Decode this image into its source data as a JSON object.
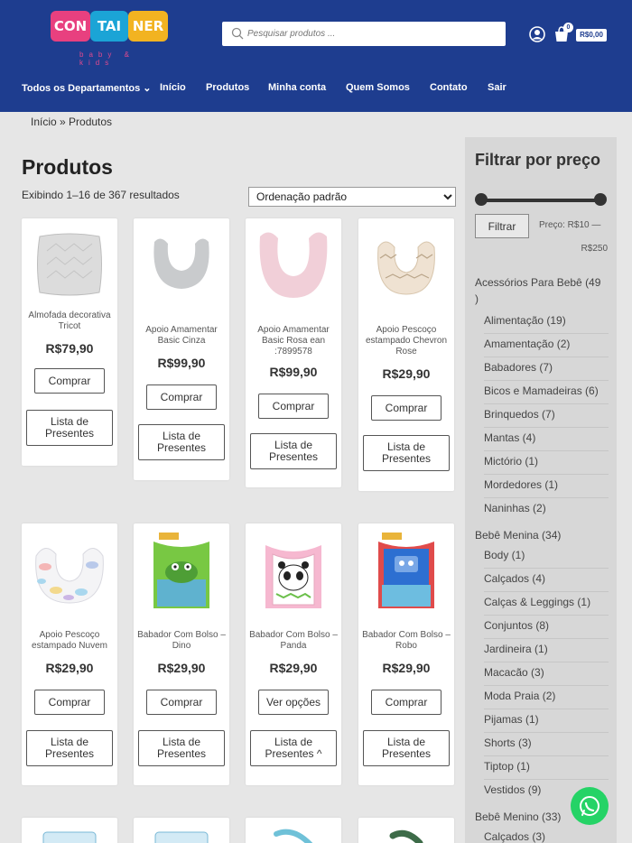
{
  "header": {
    "logo": {
      "blocks": [
        "CON",
        "TAI",
        "NER"
      ],
      "tagline": "baby & kids"
    },
    "search": {
      "placeholder": "Pesquisar produtos ..."
    },
    "cart": {
      "count": "0",
      "total": "R$0,00"
    }
  },
  "nav": {
    "items": [
      "Todos os Departamentos",
      "Início",
      "Produtos",
      "Minha conta",
      "Quem Somos",
      "Contato",
      "Sair"
    ]
  },
  "breadcrumb": "Início » Produtos",
  "main": {
    "title": "Produtos",
    "result_count": "Exibindo 1–16 de 367 resultados",
    "sort_selected": "Ordenação padrão"
  },
  "products": [
    {
      "name": "Almofada decorativa Tricot",
      "price": "R$79,90",
      "action": "Comprar",
      "list": "Lista de Presentes"
    },
    {
      "name": "Apoio Amamentar Basic Cinza",
      "price": "R$99,90",
      "action": "Comprar",
      "list": "Lista de Presentes"
    },
    {
      "name": "Apoio Amamentar Basic Rosa ean :7899578",
      "price": "R$99,90",
      "action": "Comprar",
      "list": "Lista de Presentes"
    },
    {
      "name": "Apoio Pescoço estampado Chevron Rose",
      "price": "R$29,90",
      "action": "Comprar",
      "list": "Lista de Presentes"
    },
    {
      "name": "Apoio Pescoço estampado Nuvem",
      "price": "R$29,90",
      "action": "Comprar",
      "list": "Lista de Presentes"
    },
    {
      "name": "Babador Com Bolso – Dino",
      "price": "R$29,90",
      "action": "Comprar",
      "list": "Lista de Presentes"
    },
    {
      "name": "Babador Com Bolso – Panda",
      "price": "R$29,90",
      "action": "Ver opções",
      "list": "Lista de Presentes ^"
    },
    {
      "name": "Babador Com Bolso – Robo",
      "price": "R$29,90",
      "action": "Comprar",
      "list": "Lista de Presentes"
    }
  ],
  "sidebar": {
    "filter_title": "Filtrar por preço",
    "filter_button": "Filtrar",
    "price_label": "Preço: R$10 —",
    "price_max": "R$250",
    "categories": [
      {
        "label": "Acessórios Para Bebê (49",
        "label2": ")"
      },
      {
        "label": "Alimentação (19)"
      },
      {
        "label": "Amamentação (2)"
      },
      {
        "label": "Babadores (7)"
      },
      {
        "label": "Bicos e Mamadeiras (6)"
      },
      {
        "label": "Brinquedos (7)"
      },
      {
        "label": "Mantas (4)"
      },
      {
        "label": "Mictório (1)"
      },
      {
        "label": "Mordedores (1)"
      },
      {
        "label": "Naninhas (2)"
      },
      {
        "label": "Bebê Menina (34)"
      },
      {
        "label": "Body (1)"
      },
      {
        "label": "Calçados (4)"
      },
      {
        "label": "Calças & Leggings (1)"
      },
      {
        "label": "Conjuntos (8)"
      },
      {
        "label": "Jardineira (1)"
      },
      {
        "label": "Macacão (3)"
      },
      {
        "label": "Moda Praia (2)"
      },
      {
        "label": "Pijamas (1)"
      },
      {
        "label": "Shorts (3)"
      },
      {
        "label": "Tiptop (1)"
      },
      {
        "label": "Vestidos (9)"
      },
      {
        "label": "Bebê Menino (33)"
      },
      {
        "label": "Calçados (3)"
      }
    ]
  },
  "colors": {
    "header": "#1e3d8f",
    "whatsapp": "#25d366"
  }
}
